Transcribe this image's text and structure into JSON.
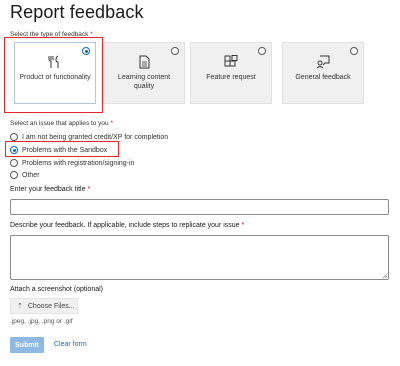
{
  "page": {
    "title": "Report feedback"
  },
  "type_section": {
    "label": "Select the type of feedback",
    "required_mark": "*",
    "cards": [
      {
        "label": "Product or functionality",
        "icon": "tools-icon",
        "selected": true
      },
      {
        "label": "Learning content quality",
        "icon": "document-icon",
        "selected": false
      },
      {
        "label": "Feature request",
        "icon": "add-apps-icon",
        "selected": false
      },
      {
        "label": "General feedback",
        "icon": "chat-person-icon",
        "selected": false
      }
    ]
  },
  "issue_section": {
    "label": "Select an issue that applies to you",
    "required_mark": "*",
    "options": [
      {
        "label": "I am not being granted credit/XP for completion",
        "selected": false
      },
      {
        "label": "Problems with the Sandbox",
        "selected": true
      },
      {
        "label": "Problems with registration/signing-in",
        "selected": false
      },
      {
        "label": "Other",
        "selected": false
      }
    ]
  },
  "title_field": {
    "label": "Enter your feedback title",
    "required_mark": "*",
    "value": ""
  },
  "description_field": {
    "label": "Describe your feedback. If applicable, include steps to replicate your issue",
    "required_mark": "*",
    "value": ""
  },
  "attachment": {
    "label": "Attach a screenshot (optional)",
    "button_label": "Choose Files...",
    "hint": ".jpeg, .jpg, .png or .gif"
  },
  "actions": {
    "submit_label": "Submit",
    "clear_label": "Clear form"
  },
  "colors": {
    "accent": "#0f6cbd",
    "highlight": "#e0282e",
    "submit_disabled": "#8fb8e2"
  }
}
